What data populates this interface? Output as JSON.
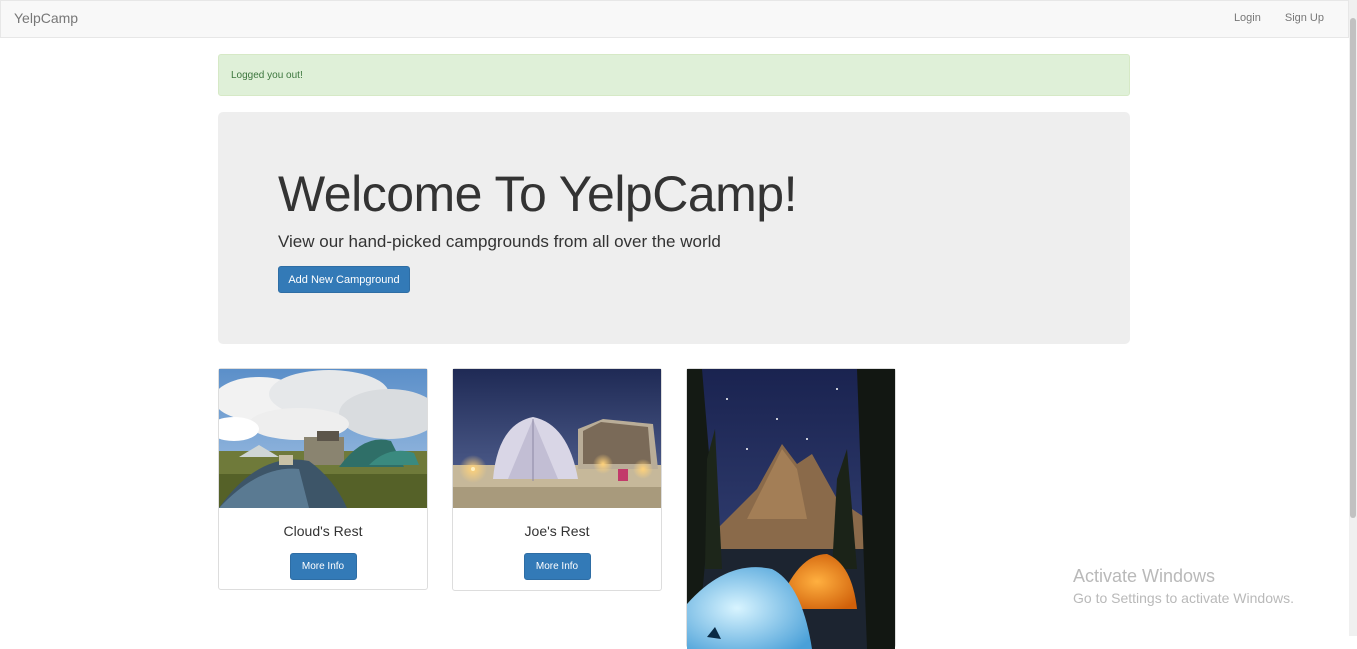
{
  "navbar": {
    "brand": "YelpCamp",
    "login": "Login",
    "signup": "Sign Up"
  },
  "alert": {
    "message": "Logged you out!"
  },
  "jumbotron": {
    "title": "Welcome To YelpCamp!",
    "subtitle": "View our hand-picked campgrounds from all over the world",
    "add_button": "Add New Campground"
  },
  "campgrounds": [
    {
      "name": "Cloud's Rest",
      "button": "More Info",
      "image": "campsite-cloudy-sky-photo"
    },
    {
      "name": "Joe's Rest",
      "button": "More Info",
      "image": "dome-tent-night-photo"
    },
    {
      "name": "",
      "button": "",
      "image": "tents-mountain-starry-night-photo"
    }
  ],
  "watermark": {
    "title": "Activate Windows",
    "subtitle": "Go to Settings to activate Windows."
  },
  "colors": {
    "primary": "#337ab7",
    "alert_bg": "#dff0d8",
    "alert_text": "#3c763d",
    "jumbotron_bg": "#eeeeee",
    "navbar_bg": "#f8f8f8"
  }
}
